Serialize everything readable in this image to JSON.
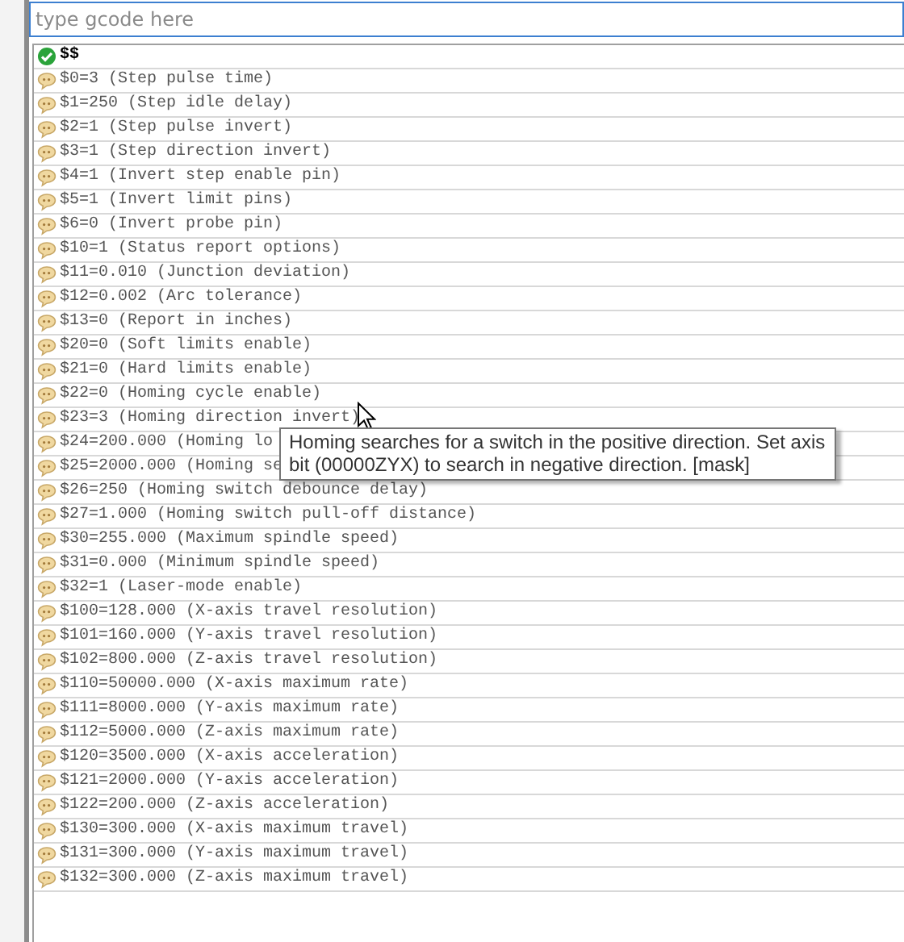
{
  "command_field": {
    "placeholder": "type gcode here"
  },
  "console": [
    {
      "kind": "ok",
      "text": "$$"
    },
    {
      "kind": "msg",
      "text": "$0=3 (Step pulse time)"
    },
    {
      "kind": "msg",
      "text": "$1=250 (Step idle delay)"
    },
    {
      "kind": "msg",
      "text": "$2=1 (Step pulse invert)"
    },
    {
      "kind": "msg",
      "text": "$3=1 (Step direction invert)"
    },
    {
      "kind": "msg",
      "text": "$4=1 (Invert step enable pin)"
    },
    {
      "kind": "msg",
      "text": "$5=1 (Invert limit pins)"
    },
    {
      "kind": "msg",
      "text": "$6=0 (Invert probe pin)"
    },
    {
      "kind": "msg",
      "text": "$10=1 (Status report options)"
    },
    {
      "kind": "msg",
      "text": "$11=0.010 (Junction deviation)"
    },
    {
      "kind": "msg",
      "text": "$12=0.002 (Arc tolerance)"
    },
    {
      "kind": "msg",
      "text": "$13=0 (Report in inches)"
    },
    {
      "kind": "msg",
      "text": "$20=0 (Soft limits enable)"
    },
    {
      "kind": "msg",
      "text": "$21=0 (Hard limits enable)"
    },
    {
      "kind": "msg",
      "text": "$22=0 (Homing cycle enable)"
    },
    {
      "kind": "msg",
      "text": "$23=3 (Homing direction invert)"
    },
    {
      "kind": "msg",
      "text": "$24=200.000 (Homing lo"
    },
    {
      "kind": "msg",
      "text": "$25=2000.000 (Homing se"
    },
    {
      "kind": "msg",
      "text": "$26=250 (Homing switch debounce delay)"
    },
    {
      "kind": "msg",
      "text": "$27=1.000 (Homing switch pull-off distance)"
    },
    {
      "kind": "msg",
      "text": "$30=255.000 (Maximum spindle speed)"
    },
    {
      "kind": "msg",
      "text": "$31=0.000 (Minimum spindle speed)"
    },
    {
      "kind": "msg",
      "text": "$32=1 (Laser-mode enable)"
    },
    {
      "kind": "msg",
      "text": "$100=128.000 (X-axis travel resolution)"
    },
    {
      "kind": "msg",
      "text": "$101=160.000 (Y-axis travel resolution)"
    },
    {
      "kind": "msg",
      "text": "$102=800.000 (Z-axis travel resolution)"
    },
    {
      "kind": "msg",
      "text": "$110=50000.000 (X-axis maximum rate)"
    },
    {
      "kind": "msg",
      "text": "$111=8000.000 (Y-axis maximum rate)"
    },
    {
      "kind": "msg",
      "text": "$112=5000.000 (Z-axis maximum rate)"
    },
    {
      "kind": "msg",
      "text": "$120=3500.000 (X-axis acceleration)"
    },
    {
      "kind": "msg",
      "text": "$121=2000.000 (Y-axis acceleration)"
    },
    {
      "kind": "msg",
      "text": "$122=200.000 (Z-axis acceleration)"
    },
    {
      "kind": "msg",
      "text": "$130=300.000 (X-axis maximum travel)"
    },
    {
      "kind": "msg",
      "text": "$131=300.000 (Y-axis maximum travel)"
    },
    {
      "kind": "msg",
      "text": "$132=300.000 (Z-axis maximum travel)"
    }
  ],
  "tooltip": {
    "text": "Homing searches for a switch in the positive direction. Set axis bit (00000ZYX) to search in negative direction. [mask]"
  }
}
